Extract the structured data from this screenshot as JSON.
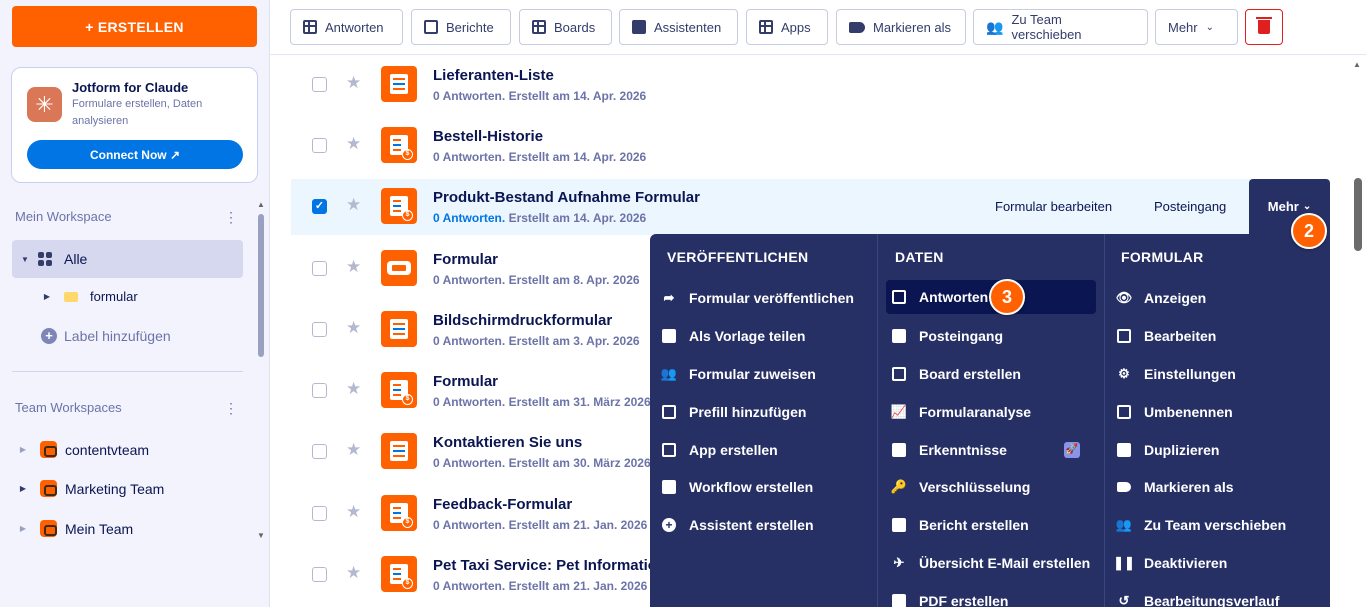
{
  "sidebar": {
    "create_label": "+ ERSTELLEN",
    "claude": {
      "title": "Jotform for Claude",
      "description": "Formulare erstellen, Daten analysieren",
      "connect_label": "Connect Now ↗"
    },
    "my_workspace": "Mein Workspace",
    "all_label": "Alle",
    "folder_label": "formular",
    "add_label": "Label hinzufügen",
    "team_workspaces": "Team Workspaces",
    "teams": [
      "contentvteam",
      "Marketing Team",
      "Mein Team"
    ]
  },
  "toolbar": {
    "buttons": [
      "Antworten",
      "Berichte",
      "Boards",
      "Assistenten",
      "Apps",
      "Markieren als",
      "Zu Team verschieben",
      "Mehr"
    ]
  },
  "forms": [
    {
      "title": "Lieferanten-Liste",
      "responses": "0 Antworten.",
      "created": "Erstellt am 14. Apr. 2026"
    },
    {
      "title": "Bestell-Historie",
      "responses": "0 Antworten.",
      "created": "Erstellt am 14. Apr. 2026"
    },
    {
      "title": "Produkt-Bestand Aufnahme Formular",
      "responses": "0 Antworten.",
      "created": "Erstellt am 14. Apr. 2026"
    },
    {
      "title": "Formular",
      "responses": "0 Antworten.",
      "created": "Erstellt am 8. Apr. 2026"
    },
    {
      "title": "Bildschirmdruckformular",
      "responses": "0 Antworten.",
      "created": "Erstellt am 3. Apr. 2026"
    },
    {
      "title": "Formular",
      "responses": "0 Antworten.",
      "created": "Erstellt am 31. März 2026"
    },
    {
      "title": "Kontaktieren Sie uns",
      "responses": "0 Antworten.",
      "created": "Erstellt am 30. März 2026"
    },
    {
      "title": "Feedback-Formular",
      "responses": "0 Antworten.",
      "created": "Erstellt am 21. Jan. 2026"
    },
    {
      "title": "Pet Taxi Service: Pet Information",
      "responses": "0 Antworten.",
      "created": "Erstellt am 21. Jan. 2026"
    }
  ],
  "row_actions": {
    "edit": "Formular bearbeiten",
    "inbox": "Posteingang",
    "more": "Mehr"
  },
  "markers": {
    "m2": "2",
    "m3": "3"
  },
  "dropdown": {
    "col1": {
      "head": "VERÖFFENTLICHEN",
      "items": [
        "Formular veröffentlichen",
        "Als Vorlage teilen",
        "Formular zuweisen",
        "Prefill hinzufügen",
        "App erstellen",
        "Workflow erstellen",
        "Assistent erstellen"
      ]
    },
    "col2": {
      "head": "DATEN",
      "items": [
        "Antworten",
        "Posteingang",
        "Board erstellen",
        "Formularanalyse",
        "Erkenntnisse",
        "Verschlüsselung",
        "Bericht erstellen",
        "Übersicht E-Mail erstellen",
        "PDF erstellen"
      ]
    },
    "col3": {
      "head": "FORMULAR",
      "items": [
        "Anzeigen",
        "Bearbeiten",
        "Einstellungen",
        "Umbenennen",
        "Duplizieren",
        "Markieren als",
        "Zu Team verschieben",
        "Deaktivieren",
        "Bearbeitungsverlauf"
      ]
    }
  },
  "colors": {
    "accent": "#ff6100",
    "primary_blue": "#0075e3",
    "navy": "#263065"
  }
}
